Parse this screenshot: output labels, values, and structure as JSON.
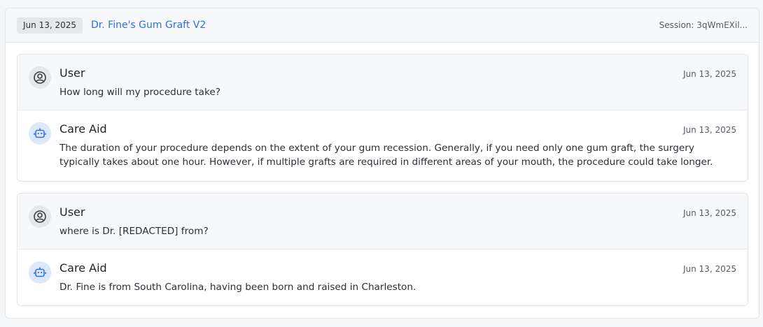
{
  "header": {
    "date": "Jun 13, 2025",
    "flow_title": "Dr. Fine's Gum Graft V2",
    "session": "Session: 3qWmEXil..."
  },
  "conversations": [
    {
      "messages": [
        {
          "sender": "User",
          "timestamp": "Jun 13, 2025",
          "text": "How long will my procedure take?",
          "icon": "user-circle-icon"
        },
        {
          "sender": "Care Aid",
          "timestamp": "Jun 13, 2025",
          "text": "The duration of your procedure depends on the extent of your gum recession. Generally, if you need only one gum graft, the surgery typically takes about one hour. However, if multiple grafts are required in different areas of your mouth, the procedure could take longer.",
          "icon": "robot-icon"
        }
      ]
    },
    {
      "messages": [
        {
          "sender": "User",
          "timestamp": "Jun 13, 2025",
          "text": "where is Dr. [REDACTED] from?",
          "icon": "user-circle-icon"
        },
        {
          "sender": "Care Aid",
          "timestamp": "Jun 13, 2025",
          "text": "Dr. Fine is from South Carolina, having been born and raised in Charleston.",
          "icon": "robot-icon"
        }
      ]
    }
  ],
  "colors": {
    "link": "#2f6fe0",
    "bot_avatar_bg": "#dde8fb",
    "user_avatar_bg": "#e6e7ea"
  }
}
